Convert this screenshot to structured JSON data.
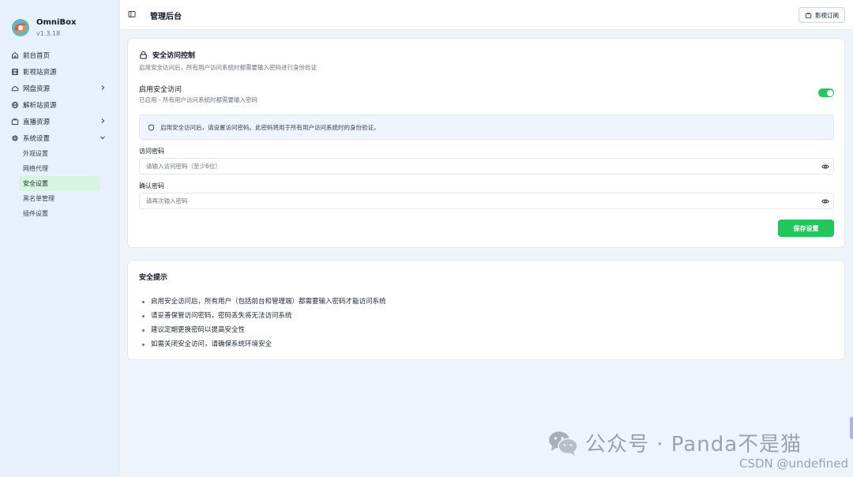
{
  "app": {
    "name": "OmniBox",
    "version": "v1.3.18"
  },
  "sidebar": {
    "items": [
      {
        "label": "前台首页",
        "icon": "home-icon"
      },
      {
        "label": "影视站资源",
        "icon": "film-icon"
      },
      {
        "label": "网盘资源",
        "icon": "cloud-icon",
        "expandable": true
      },
      {
        "label": "解析站资源",
        "icon": "globe-icon"
      },
      {
        "label": "直播资源",
        "icon": "tv-icon",
        "expandable": true
      },
      {
        "label": "系统设置",
        "icon": "gear-icon",
        "expanded": true
      }
    ],
    "sub_items": [
      "外观设置",
      "网络代理",
      "安全设置",
      "黑名单管理",
      "插件设置"
    ],
    "active_sub": "安全设置"
  },
  "header": {
    "title": "管理后台",
    "subscribe_label": "影视订阅"
  },
  "security": {
    "title": "安全访问控制",
    "desc": "启用安全访问后，所有用户访问系统时都需要输入密码进行身份验证",
    "enable_label": "启用安全访问",
    "enable_desc": "已启用 - 所有用户访问系统时都需要输入密码",
    "enabled": true,
    "notice": "启用安全访问后，请设置访问密码。此密码将用于所有用户访问系统时的身份验证。",
    "password_label": "访问密码",
    "password_placeholder": "请输入访问密码（至少6位）",
    "password_value": "",
    "confirm_label": "确认密码",
    "confirm_placeholder": "请再次输入密码",
    "confirm_value": "",
    "save_label": "保存设置"
  },
  "tips": {
    "title": "安全提示",
    "items": [
      "启用安全访问后，所有用户（包括前台和管理端）都需要输入密码才能访问系统",
      "请妥善保管访问密码，密码丢失将无法访问系统",
      "建议定期更换密码以提高安全性",
      "如需关闭安全访问，请确保系统环境安全"
    ]
  },
  "watermarks": {
    "wechat": "公众号 · Panda不是猫",
    "csdn": "CSDN @undefined"
  },
  "colors": {
    "accent": "#22c55e",
    "active_bg": "#d6f5e1",
    "sidebar_bg": "#e8f1fb",
    "page_bg": "#eef4fb"
  }
}
